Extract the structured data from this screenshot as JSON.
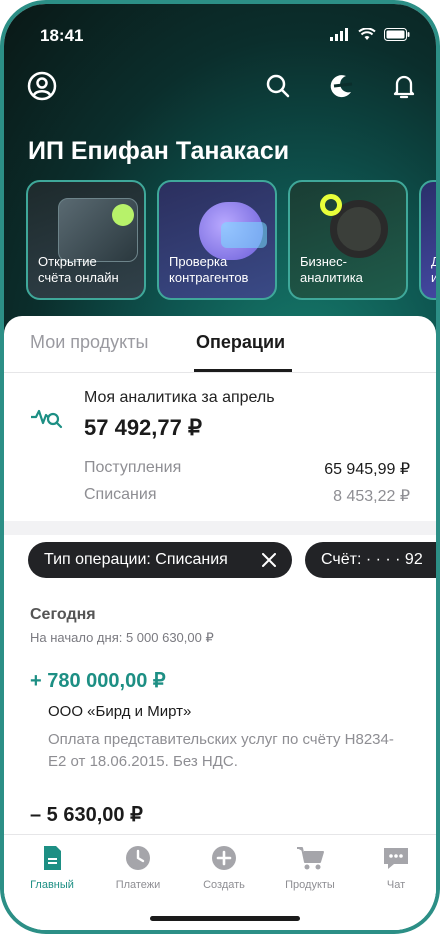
{
  "status_bar": {
    "time": "18:41"
  },
  "header": {
    "company_name": "ИП Епифан Танакаси"
  },
  "stories": [
    {
      "label_line1": "Открытие",
      "label_line2": "счёта онлайн"
    },
    {
      "label_line1": "Проверка",
      "label_line2": "контрагентов"
    },
    {
      "label_line1": "Бизнес-",
      "label_line2": "аналитика"
    },
    {
      "label_line1": "Д",
      "label_line2": "и"
    }
  ],
  "tabs": [
    {
      "label": "Мои продукты",
      "active": false
    },
    {
      "label": "Операции",
      "active": true
    }
  ],
  "analytics": {
    "title": "Моя аналитика за апрель",
    "total": "57 492,77 ₽",
    "income_label": "Поступления",
    "income_value": "65 945,99 ₽",
    "expense_label": "Списания",
    "expense_value": "8 453,22 ₽"
  },
  "filters": [
    {
      "label": "Тип операции: Списания"
    },
    {
      "label": "Счёт: · · · · 92"
    }
  ],
  "operations": {
    "day_label": "Сегодня",
    "day_start": "На начало дня: 5 000 630,00 ₽",
    "items": [
      {
        "amount": "+ 780 000,00 ₽",
        "counterparty": "ООО «Бирд и Мирт»",
        "description": "Оплата представительских услуг по счёту Н8234-Е2 от 18.06.2015. Без НДС."
      },
      {
        "amount": "– 5 630,00 ₽"
      }
    ]
  },
  "bottom_nav": [
    {
      "label": "Главный",
      "icon": "document-icon",
      "active": true
    },
    {
      "label": "Платежи",
      "icon": "clock-icon",
      "active": false
    },
    {
      "label": "Создать",
      "icon": "plus-icon",
      "active": false
    },
    {
      "label": "Продукты",
      "icon": "cart-icon",
      "active": false
    },
    {
      "label": "Чат",
      "icon": "chat-icon",
      "active": false
    }
  ],
  "colors": {
    "accent": "#1d8f84",
    "income": "#1d8f84",
    "chip_bg": "#222326"
  }
}
